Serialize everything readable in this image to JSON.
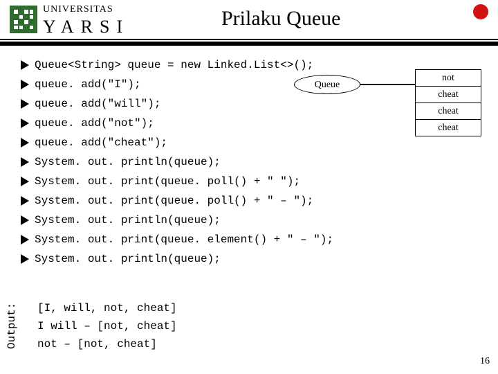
{
  "brand": {
    "top": "UNIVERSITAS",
    "bottom": "YARSI"
  },
  "title": "Prilaku Queue",
  "code_lines": [
    "Queue<String> queue = new Linked.List<>();",
    "queue. add(\"I\");",
    "queue. add(\"will\");",
    "queue. add(\"not\");",
    "queue. add(\"cheat\");",
    "System. out. println(queue);",
    "System. out. print(queue. poll() + \" \");",
    "System. out. print(queue. poll() + \" – \");",
    "System. out. println(queue);",
    "System. out. print(queue. element() + \" – \");",
    "System. out. println(queue);"
  ],
  "queue_label": "Queue",
  "queue_cells": [
    "not",
    "cheat",
    "cheat",
    "cheat"
  ],
  "output_label": "Output:",
  "output_lines": [
    "[I, will, not, cheat]",
    "I will – [not, cheat]",
    "not – [not, cheat]"
  ],
  "page_number": "16"
}
